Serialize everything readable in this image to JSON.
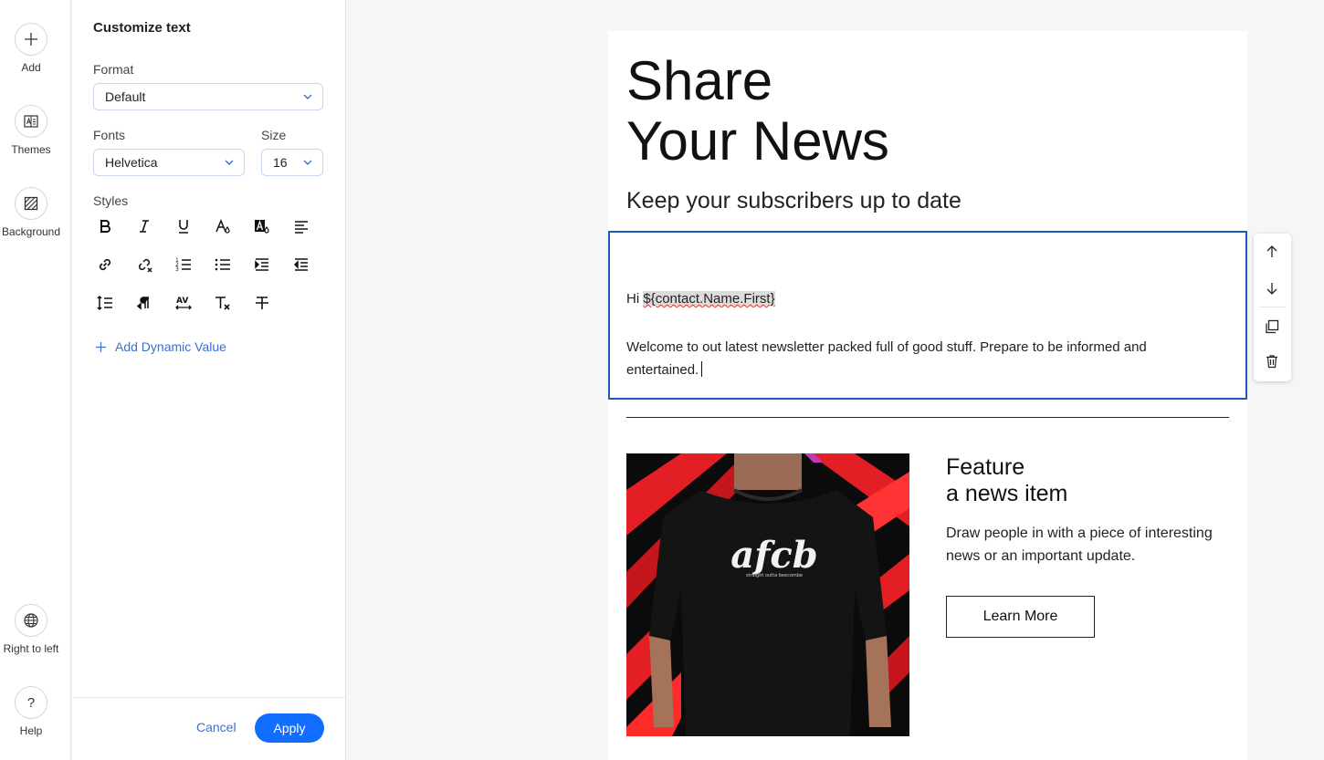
{
  "rail": {
    "add": {
      "label": "Add",
      "icon": "plus-icon"
    },
    "themes": {
      "label": "Themes",
      "icon": "themes-icon"
    },
    "background": {
      "label": "Background",
      "icon": "background-icon"
    },
    "rtl": {
      "label": "Right to left",
      "icon": "globe-icon"
    },
    "help": {
      "label": "Help",
      "icon": "question-icon"
    }
  },
  "panel": {
    "title": "Customize text",
    "format_label": "Format",
    "format_value": "Default",
    "fonts_label": "Fonts",
    "font_value": "Helvetica",
    "size_label": "Size",
    "size_value": "16",
    "styles_label": "Styles",
    "style_tools": [
      "bold-icon",
      "italic-icon",
      "underline-icon",
      "text-color-icon",
      "highlight-color-icon",
      "align-left-icon",
      "link-icon",
      "unlink-icon",
      "numbered-list-icon",
      "bullet-list-icon",
      "indent-icon",
      "outdent-icon",
      "line-height-icon",
      "text-direction-icon",
      "letter-spacing-icon",
      "clear-format-icon",
      "strikethrough-icon"
    ],
    "add_dynamic": "Add Dynamic Value",
    "cancel": "Cancel",
    "apply": "Apply"
  },
  "email": {
    "title_line1": "Share",
    "title_line2": "Your News",
    "subtitle": "Keep your subscribers up to date",
    "greeting_prefix": "Hi ",
    "greeting_token": "${contact.Name.First}",
    "welcome": "Welcome to out latest newsletter packed full of good stuff. Prepare to be informed and entertained.",
    "feature_title_line1": "Feature",
    "feature_title_line2": "a news item",
    "feature_desc": "Draw people in with a piece of interesting news or an important update.",
    "learn_more": "Learn More",
    "shirt_logo": "afcb",
    "shirt_tagline": "straight outta beecombe"
  },
  "float_tools": [
    "move-up-icon",
    "move-down-icon",
    "duplicate-icon",
    "delete-icon"
  ],
  "colors": {
    "accent": "#116dff",
    "link": "#3b6fd6",
    "selection_border": "#1e5bb8",
    "image_red": "#e31e24"
  }
}
